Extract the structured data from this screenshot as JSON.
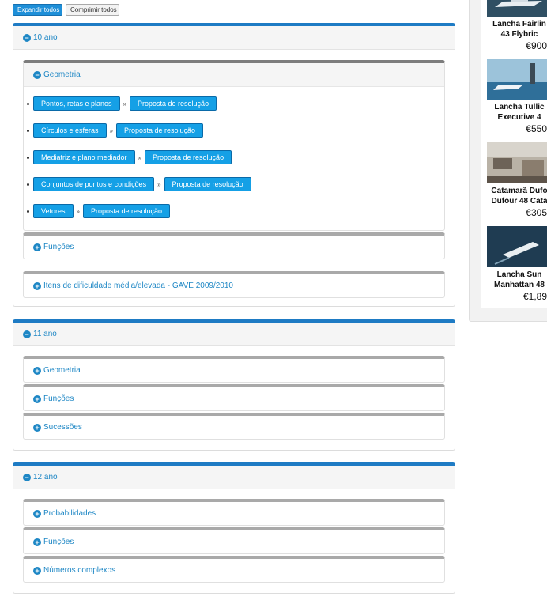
{
  "toolbar": {
    "expand_all": "Expandir todos",
    "collapse_all": "Comprimir todos"
  },
  "separator": "»",
  "years": [
    {
      "title": "10 ano",
      "state": "expanded",
      "sections": [
        {
          "title": "Geometria",
          "state": "expanded",
          "topics": [
            {
              "label": "Pontos, retas e planos",
              "solution": "Proposta de resolução"
            },
            {
              "label": "Círculos e esferas",
              "solution": "Proposta de resolução"
            },
            {
              "label": "Mediatriz e plano mediador",
              "solution": "Proposta de resolução"
            },
            {
              "label": "Conjuntos de pontos e condições",
              "solution": "Proposta de resolução"
            },
            {
              "label": "Vetores",
              "solution": "Proposta de resolução"
            }
          ]
        },
        {
          "title": "Funções",
          "state": "collapsed"
        },
        {
          "title": "Itens de dificuldade média/elevada - GAVE 2009/2010",
          "state": "collapsed"
        }
      ]
    },
    {
      "title": "11 ano",
      "state": "expanded",
      "sections": [
        {
          "title": "Geometria",
          "state": "collapsed"
        },
        {
          "title": "Funções",
          "state": "collapsed"
        },
        {
          "title": "Sucessões",
          "state": "collapsed"
        }
      ]
    },
    {
      "title": "12 ano",
      "state": "expanded",
      "sections": [
        {
          "title": "Probabilidades",
          "state": "collapsed"
        },
        {
          "title": "Funções",
          "state": "collapsed"
        },
        {
          "title": "Números complexos",
          "state": "collapsed"
        }
      ]
    }
  ],
  "ads": [
    {
      "title_line1": "Lancha Fairlin",
      "title_line2": "43 Flybric",
      "price": "€900",
      "photo": "boat-sea-photo"
    },
    {
      "title_line1": "Lancha Tullic",
      "title_line2": "Executive 4",
      "price": "€550",
      "photo": "boat-lighthouse-photo"
    },
    {
      "title_line1": "Catamarã Dufo",
      "title_line2": "Dufour 48 Cata",
      "price": "€305",
      "photo": "catamaran-deck-photo"
    },
    {
      "title_line1": "Lancha Sun",
      "title_line2": "Manhattan 48",
      "price": "€1,89",
      "photo": "boat-aerial-photo"
    }
  ],
  "colors": {
    "accent": "#1e87c5",
    "chip": "#15a0e6",
    "year_border": "#1e7bc4"
  }
}
